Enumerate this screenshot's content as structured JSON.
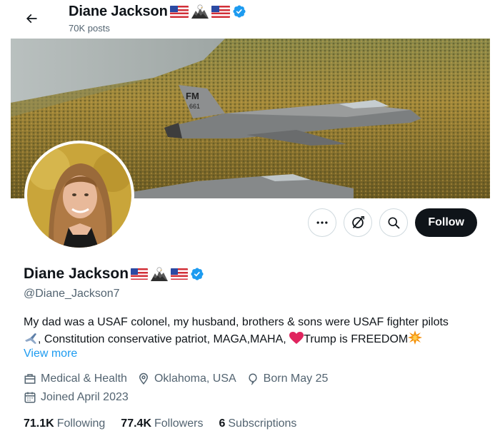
{
  "header": {
    "back_icon": "arrow-left-icon",
    "name": "Diane Jackson",
    "posts": "70K posts"
  },
  "banner": {
    "description_icon": "banner-image"
  },
  "actions": {
    "more_icon": "more-dots-icon",
    "grok_icon": "grok-icon",
    "search_icon": "search-icon",
    "follow_label": "Follow"
  },
  "profile": {
    "name": "Diane Jackson",
    "handle": "@Diane_Jackson7",
    "bio_line1": "My dad was a USAF colonel, my husband, brothers & sons were USAF fighter pilots",
    "bio_line2_a": ", Constitution conservative patriot, MAGA,MAHA, ",
    "bio_line2_b": "Trump is FREEDOM",
    "view_more": "View more",
    "category": "Medical & Health",
    "location": "Oklahoma, USA",
    "born": "Born May 25",
    "joined": "Joined April 2023"
  },
  "stats": {
    "following_count": "71.1K",
    "following_label": "Following",
    "followers_count": "77.4K",
    "followers_label": "Followers",
    "subscriptions_count": "6",
    "subscriptions_label": "Subscriptions"
  },
  "colors": {
    "accent": "#1d9bf0",
    "secondary_text": "#536471",
    "primary_text": "#0f1419"
  }
}
